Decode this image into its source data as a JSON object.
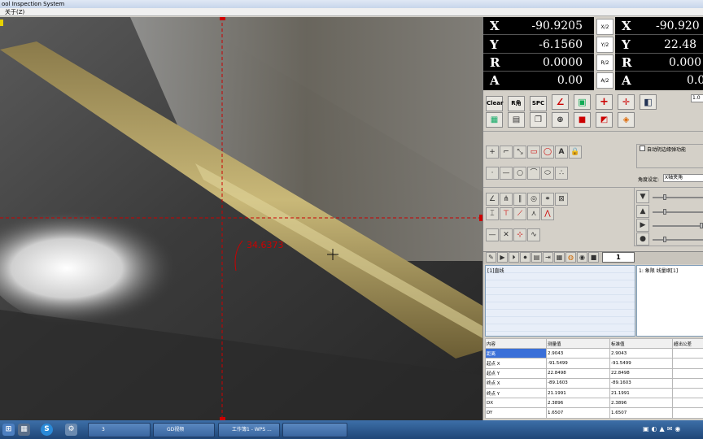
{
  "window": {
    "title": "ool Inspection System",
    "menu": "关于(Z)"
  },
  "camera": {
    "measurement": "34.6373"
  },
  "dro_left": [
    {
      "axis": "X",
      "value": "-90.9205",
      "btn": "X/2"
    },
    {
      "axis": "Y",
      "value": "-6.1560",
      "btn": "Y/2"
    },
    {
      "axis": "R",
      "value": "0.0000",
      "btn": "R/2"
    },
    {
      "axis": "A",
      "value": "0.00",
      "btn": "A/2"
    }
  ],
  "dro_right": [
    {
      "axis": "X",
      "value": "-90.920"
    },
    {
      "axis": "Y",
      "value": "22.48"
    },
    {
      "axis": "R",
      "value": "0.000"
    },
    {
      "axis": "A",
      "value": "0.0"
    }
  ],
  "toolbar": {
    "clear": "Clear",
    "r_angle": "R角",
    "spc": "SPC",
    "zoom_value": "1.0"
  },
  "options": {
    "auto_clamp": "自动阴边缘弹功能",
    "angle_label": "角度设定:",
    "angle_value": "X轴夹角"
  },
  "sequence": {
    "counter": "1",
    "list_item": "[1]直线",
    "info": "1: 象限 线量纲[1]"
  },
  "colors": {
    "dro_bg": "#000000",
    "accent": "#cc0000",
    "selection": "#3a6fd8"
  },
  "results": {
    "headers": [
      "内容",
      "测量值",
      "标准值",
      "超出公差"
    ],
    "rows": [
      [
        "距离",
        "2.9043",
        "2.9043",
        ""
      ],
      [
        "起点 X",
        "-91.5499",
        "-91.5499",
        ""
      ],
      [
        "起点 Y",
        "22.8498",
        "22.8498",
        ""
      ],
      [
        "终点 X",
        "-89.1603",
        "-89.1603",
        ""
      ],
      [
        "终点 Y",
        "21.1991",
        "21.1991",
        ""
      ],
      [
        "DX",
        "2.3896",
        "2.3896",
        ""
      ],
      [
        "DY",
        "1.6507",
        "1.6507",
        ""
      ]
    ]
  },
  "taskbar": {
    "items": [
      "3",
      "GD视频",
      "工作簿1 - WPS ..."
    ]
  }
}
